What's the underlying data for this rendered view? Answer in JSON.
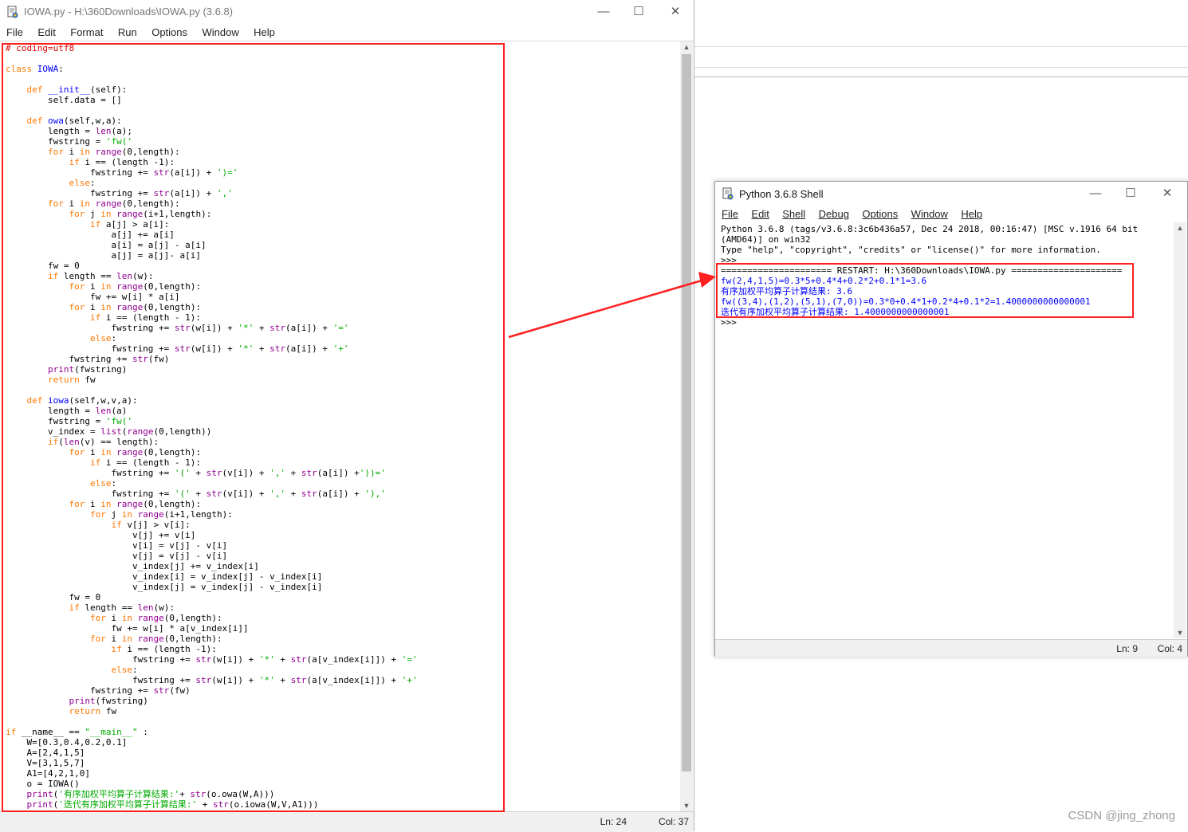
{
  "editor": {
    "title": "IOWA.py - H:\\360Downloads\\IOWA.py (3.6.8)",
    "menu": [
      "File",
      "Edit",
      "Format",
      "Run",
      "Options",
      "Window",
      "Help"
    ],
    "status_line": "Ln: 24",
    "status_col": "Col: 37"
  },
  "shell": {
    "title": "Python 3.6.8 Shell",
    "menu": [
      "File",
      "Edit",
      "Shell",
      "Debug",
      "Options",
      "Window",
      "Help"
    ],
    "lines": [
      {
        "text": "Python 3.6.8 (tags/v3.6.8:3c6b436a57, Dec 24 2018, 00:16:47) [MSC v.1916 64 bit",
        "style": "normal"
      },
      {
        "text": "(AMD64)] on win32",
        "style": "normal"
      },
      {
        "text": "Type \"help\", \"copyright\", \"credits\" or \"license()\" for more information.",
        "style": "normal"
      },
      {
        "text": ">>> ",
        "style": "normal"
      },
      {
        "text": "===================== RESTART: H:\\360Downloads\\IOWA.py =====================",
        "style": "normal"
      },
      {
        "text": "fw(2,4,1,5)=0.3*5+0.4*4+0.2*2+0.1*1=3.6",
        "style": "out"
      },
      {
        "text": "有序加权平均算子计算结果: 3.6",
        "style": "out"
      },
      {
        "text": "fw((3,4),(1,2),(5,1),(7,0))=0.3*0+0.4*1+0.2*4+0.1*2=1.4000000000000001",
        "style": "out"
      },
      {
        "text": "迭代有序加权平均算子计算结果: 1.4000000000000001",
        "style": "out"
      },
      {
        "text": ">>> ",
        "style": "normal"
      }
    ],
    "status_line": "Ln: 9",
    "status_col": "Col: 4"
  },
  "code_lines": [
    [
      [
        "# coding=utf8",
        "cm"
      ]
    ],
    [
      [
        "",
        ""
      ]
    ],
    [
      [
        "class",
        "kw"
      ],
      [
        " ",
        ""
      ],
      [
        "IOWA",
        "df"
      ],
      [
        ":",
        ""
      ]
    ],
    [
      [
        "",
        ""
      ]
    ],
    [
      [
        "    ",
        ""
      ],
      [
        "def",
        "kw"
      ],
      [
        " ",
        ""
      ],
      [
        "__init__",
        "df"
      ],
      [
        "(self):",
        ""
      ]
    ],
    [
      [
        "        self.data = []",
        ""
      ]
    ],
    [
      [
        "",
        ""
      ]
    ],
    [
      [
        "    ",
        ""
      ],
      [
        "def",
        "kw"
      ],
      [
        " ",
        ""
      ],
      [
        "owa",
        "df"
      ],
      [
        "(self,w,a):",
        ""
      ]
    ],
    [
      [
        "        length = ",
        ""
      ],
      [
        "len",
        "bi"
      ],
      [
        "(a);",
        ""
      ]
    ],
    [
      [
        "        fwstring = ",
        ""
      ],
      [
        "'fw('",
        "st"
      ]
    ],
    [
      [
        "        ",
        ""
      ],
      [
        "for",
        "kw"
      ],
      [
        " i ",
        ""
      ],
      [
        "in",
        "kw"
      ],
      [
        " ",
        ""
      ],
      [
        "range",
        "bi"
      ],
      [
        "(0,length):",
        ""
      ]
    ],
    [
      [
        "            ",
        ""
      ],
      [
        "if",
        "kw"
      ],
      [
        " i == (length -1):",
        ""
      ]
    ],
    [
      [
        "                fwstring += ",
        ""
      ],
      [
        "str",
        "bi"
      ],
      [
        "(a[i]) + ",
        ""
      ],
      [
        "')='",
        "st"
      ]
    ],
    [
      [
        "            ",
        ""
      ],
      [
        "else",
        "kw"
      ],
      [
        ":",
        ""
      ]
    ],
    [
      [
        "                fwstring += ",
        ""
      ],
      [
        "str",
        "bi"
      ],
      [
        "(a[i]) + ",
        ""
      ],
      [
        "','",
        "st"
      ]
    ],
    [
      [
        "        ",
        ""
      ],
      [
        "for",
        "kw"
      ],
      [
        " i ",
        ""
      ],
      [
        "in",
        "kw"
      ],
      [
        " ",
        ""
      ],
      [
        "range",
        "bi"
      ],
      [
        "(0,length):",
        ""
      ]
    ],
    [
      [
        "            ",
        ""
      ],
      [
        "for",
        "kw"
      ],
      [
        " j ",
        ""
      ],
      [
        "in",
        "kw"
      ],
      [
        " ",
        ""
      ],
      [
        "range",
        "bi"
      ],
      [
        "(i+1,length):",
        ""
      ]
    ],
    [
      [
        "                ",
        ""
      ],
      [
        "if",
        "kw"
      ],
      [
        " a[j] > a[i]:",
        ""
      ]
    ],
    [
      [
        "                    a[j] += a[i]",
        ""
      ]
    ],
    [
      [
        "                    a[i] = a[j] - a[i]",
        ""
      ]
    ],
    [
      [
        "                    a[j] = a[j]- a[i]",
        ""
      ]
    ],
    [
      [
        "        fw = 0",
        ""
      ]
    ],
    [
      [
        "        ",
        ""
      ],
      [
        "if",
        "kw"
      ],
      [
        " length == ",
        ""
      ],
      [
        "len",
        "bi"
      ],
      [
        "(w):",
        ""
      ]
    ],
    [
      [
        "            ",
        ""
      ],
      [
        "for",
        "kw"
      ],
      [
        " i ",
        ""
      ],
      [
        "in",
        "kw"
      ],
      [
        " ",
        ""
      ],
      [
        "range",
        "bi"
      ],
      [
        "(0,length):",
        ""
      ]
    ],
    [
      [
        "                fw += w[i] * a[i]",
        ""
      ]
    ],
    [
      [
        "            ",
        ""
      ],
      [
        "for",
        "kw"
      ],
      [
        " i ",
        ""
      ],
      [
        "in",
        "kw"
      ],
      [
        " ",
        ""
      ],
      [
        "range",
        "bi"
      ],
      [
        "(0,length):",
        ""
      ]
    ],
    [
      [
        "                ",
        ""
      ],
      [
        "if",
        "kw"
      ],
      [
        " i == (length - 1):",
        ""
      ]
    ],
    [
      [
        "                    fwstring += ",
        ""
      ],
      [
        "str",
        "bi"
      ],
      [
        "(w[i]) + ",
        ""
      ],
      [
        "'*'",
        "st"
      ],
      [
        " + ",
        ""
      ],
      [
        "str",
        "bi"
      ],
      [
        "(a[i]) + ",
        ""
      ],
      [
        "'='",
        "st"
      ]
    ],
    [
      [
        "                ",
        ""
      ],
      [
        "else",
        "kw"
      ],
      [
        ":",
        ""
      ]
    ],
    [
      [
        "                    fwstring += ",
        ""
      ],
      [
        "str",
        "bi"
      ],
      [
        "(w[i]) + ",
        ""
      ],
      [
        "'*'",
        "st"
      ],
      [
        " + ",
        ""
      ],
      [
        "str",
        "bi"
      ],
      [
        "(a[i]) + ",
        ""
      ],
      [
        "'+'",
        "st"
      ]
    ],
    [
      [
        "            fwstring += ",
        ""
      ],
      [
        "str",
        "bi"
      ],
      [
        "(fw)",
        ""
      ]
    ],
    [
      [
        "        ",
        ""
      ],
      [
        "print",
        "bi"
      ],
      [
        "(fwstring)",
        ""
      ]
    ],
    [
      [
        "        ",
        ""
      ],
      [
        "return",
        "kw"
      ],
      [
        " fw",
        ""
      ]
    ],
    [
      [
        "",
        ""
      ]
    ],
    [
      [
        "    ",
        ""
      ],
      [
        "def",
        "kw"
      ],
      [
        " ",
        ""
      ],
      [
        "iowa",
        "df"
      ],
      [
        "(self,w,v,a):",
        ""
      ]
    ],
    [
      [
        "        length = ",
        ""
      ],
      [
        "len",
        "bi"
      ],
      [
        "(a)",
        ""
      ]
    ],
    [
      [
        "        fwstring = ",
        ""
      ],
      [
        "'fw('",
        "st"
      ]
    ],
    [
      [
        "        v_index = ",
        ""
      ],
      [
        "list",
        "bi"
      ],
      [
        "(",
        ""
      ],
      [
        "range",
        "bi"
      ],
      [
        "(0,length))",
        ""
      ]
    ],
    [
      [
        "        ",
        ""
      ],
      [
        "if",
        "kw"
      ],
      [
        "(",
        ""
      ],
      [
        "len",
        "bi"
      ],
      [
        "(v) == length):",
        ""
      ]
    ],
    [
      [
        "            ",
        ""
      ],
      [
        "for",
        "kw"
      ],
      [
        " i ",
        ""
      ],
      [
        "in",
        "kw"
      ],
      [
        " ",
        ""
      ],
      [
        "range",
        "bi"
      ],
      [
        "(0,length):",
        ""
      ]
    ],
    [
      [
        "                ",
        ""
      ],
      [
        "if",
        "kw"
      ],
      [
        " i == (length - 1):",
        ""
      ]
    ],
    [
      [
        "                    fwstring += ",
        ""
      ],
      [
        "'('",
        "st"
      ],
      [
        " + ",
        ""
      ],
      [
        "str",
        "bi"
      ],
      [
        "(v[i]) + ",
        ""
      ],
      [
        "','",
        "st"
      ],
      [
        " + ",
        ""
      ],
      [
        "str",
        "bi"
      ],
      [
        "(a[i]) +",
        ""
      ],
      [
        "'))='",
        "st"
      ]
    ],
    [
      [
        "                ",
        ""
      ],
      [
        "else",
        "kw"
      ],
      [
        ":",
        ""
      ]
    ],
    [
      [
        "                    fwstring += ",
        ""
      ],
      [
        "'('",
        "st"
      ],
      [
        " + ",
        ""
      ],
      [
        "str",
        "bi"
      ],
      [
        "(v[i]) + ",
        ""
      ],
      [
        "','",
        "st"
      ],
      [
        " + ",
        ""
      ],
      [
        "str",
        "bi"
      ],
      [
        "(a[i]) + ",
        ""
      ],
      [
        "'),'",
        "st"
      ]
    ],
    [
      [
        "            ",
        ""
      ],
      [
        "for",
        "kw"
      ],
      [
        " i ",
        ""
      ],
      [
        "in",
        "kw"
      ],
      [
        " ",
        ""
      ],
      [
        "range",
        "bi"
      ],
      [
        "(0,length):",
        ""
      ]
    ],
    [
      [
        "                ",
        ""
      ],
      [
        "for",
        "kw"
      ],
      [
        " j ",
        ""
      ],
      [
        "in",
        "kw"
      ],
      [
        " ",
        ""
      ],
      [
        "range",
        "bi"
      ],
      [
        "(i+1,length):",
        ""
      ]
    ],
    [
      [
        "                    ",
        ""
      ],
      [
        "if",
        "kw"
      ],
      [
        " v[j] > v[i]:",
        ""
      ]
    ],
    [
      [
        "                        v[j] += v[i]",
        ""
      ]
    ],
    [
      [
        "                        v[i] = v[j] - v[i]",
        ""
      ]
    ],
    [
      [
        "                        v[j] = v[j] - v[i]",
        ""
      ]
    ],
    [
      [
        "                        v_index[j] += v_index[i]",
        ""
      ]
    ],
    [
      [
        "                        v_index[i] = v_index[j] - v_index[i]",
        ""
      ]
    ],
    [
      [
        "                        v_index[j] = v_index[j] - v_index[i]",
        ""
      ]
    ],
    [
      [
        "            fw = 0",
        ""
      ]
    ],
    [
      [
        "            ",
        ""
      ],
      [
        "if",
        "kw"
      ],
      [
        " length == ",
        ""
      ],
      [
        "len",
        "bi"
      ],
      [
        "(w):",
        ""
      ]
    ],
    [
      [
        "                ",
        ""
      ],
      [
        "for",
        "kw"
      ],
      [
        " i ",
        ""
      ],
      [
        "in",
        "kw"
      ],
      [
        " ",
        ""
      ],
      [
        "range",
        "bi"
      ],
      [
        "(0,length):",
        ""
      ]
    ],
    [
      [
        "                    fw += w[i] * a[v_index[i]]",
        ""
      ]
    ],
    [
      [
        "                ",
        ""
      ],
      [
        "for",
        "kw"
      ],
      [
        " i ",
        ""
      ],
      [
        "in",
        "kw"
      ],
      [
        " ",
        ""
      ],
      [
        "range",
        "bi"
      ],
      [
        "(0,length):",
        ""
      ]
    ],
    [
      [
        "                    ",
        ""
      ],
      [
        "if",
        "kw"
      ],
      [
        " i == (length -1):",
        ""
      ]
    ],
    [
      [
        "                        fwstring += ",
        ""
      ],
      [
        "str",
        "bi"
      ],
      [
        "(w[i]) + ",
        ""
      ],
      [
        "'*'",
        "st"
      ],
      [
        " + ",
        ""
      ],
      [
        "str",
        "bi"
      ],
      [
        "(a[v_index[i]]) + ",
        ""
      ],
      [
        "'='",
        "st"
      ]
    ],
    [
      [
        "                    ",
        ""
      ],
      [
        "else",
        "kw"
      ],
      [
        ":",
        ""
      ]
    ],
    [
      [
        "                        fwstring += ",
        ""
      ],
      [
        "str",
        "bi"
      ],
      [
        "(w[i]) + ",
        ""
      ],
      [
        "'*'",
        "st"
      ],
      [
        " + ",
        ""
      ],
      [
        "str",
        "bi"
      ],
      [
        "(a[v_index[i]]) + ",
        ""
      ],
      [
        "'+'",
        "st"
      ]
    ],
    [
      [
        "                fwstring += ",
        ""
      ],
      [
        "str",
        "bi"
      ],
      [
        "(fw)",
        ""
      ]
    ],
    [
      [
        "            ",
        ""
      ],
      [
        "print",
        "bi"
      ],
      [
        "(fwstring)",
        ""
      ]
    ],
    [
      [
        "            ",
        ""
      ],
      [
        "return",
        "kw"
      ],
      [
        " fw",
        ""
      ]
    ],
    [
      [
        "",
        ""
      ]
    ],
    [
      [
        "if",
        "kw"
      ],
      [
        " __name__ == ",
        ""
      ],
      [
        "\"__main__\"",
        "st"
      ],
      [
        " :",
        ""
      ]
    ],
    [
      [
        "    W=[0.3,0.4,0.2,0.1]",
        ""
      ]
    ],
    [
      [
        "    A=[2,4,1,5]",
        ""
      ]
    ],
    [
      [
        "    V=[3,1,5,7]",
        ""
      ]
    ],
    [
      [
        "    A1=[4,2,1,0]",
        ""
      ]
    ],
    [
      [
        "    o = IOWA()",
        ""
      ]
    ],
    [
      [
        "    ",
        ""
      ],
      [
        "print",
        "bi"
      ],
      [
        "(",
        ""
      ],
      [
        "'有序加权平均算子计算结果:'",
        "st"
      ],
      [
        "+ ",
        ""
      ],
      [
        "str",
        "bi"
      ],
      [
        "(o.owa(W,A)))",
        ""
      ]
    ],
    [
      [
        "    ",
        ""
      ],
      [
        "print",
        "bi"
      ],
      [
        "(",
        ""
      ],
      [
        "'迭代有序加权平均算子计算结果:'",
        "st"
      ],
      [
        " + ",
        ""
      ],
      [
        "str",
        "bi"
      ],
      [
        "(o.iowa(W,V,A1)))",
        ""
      ]
    ]
  ],
  "watermark": "CSDN @jing_zhong"
}
